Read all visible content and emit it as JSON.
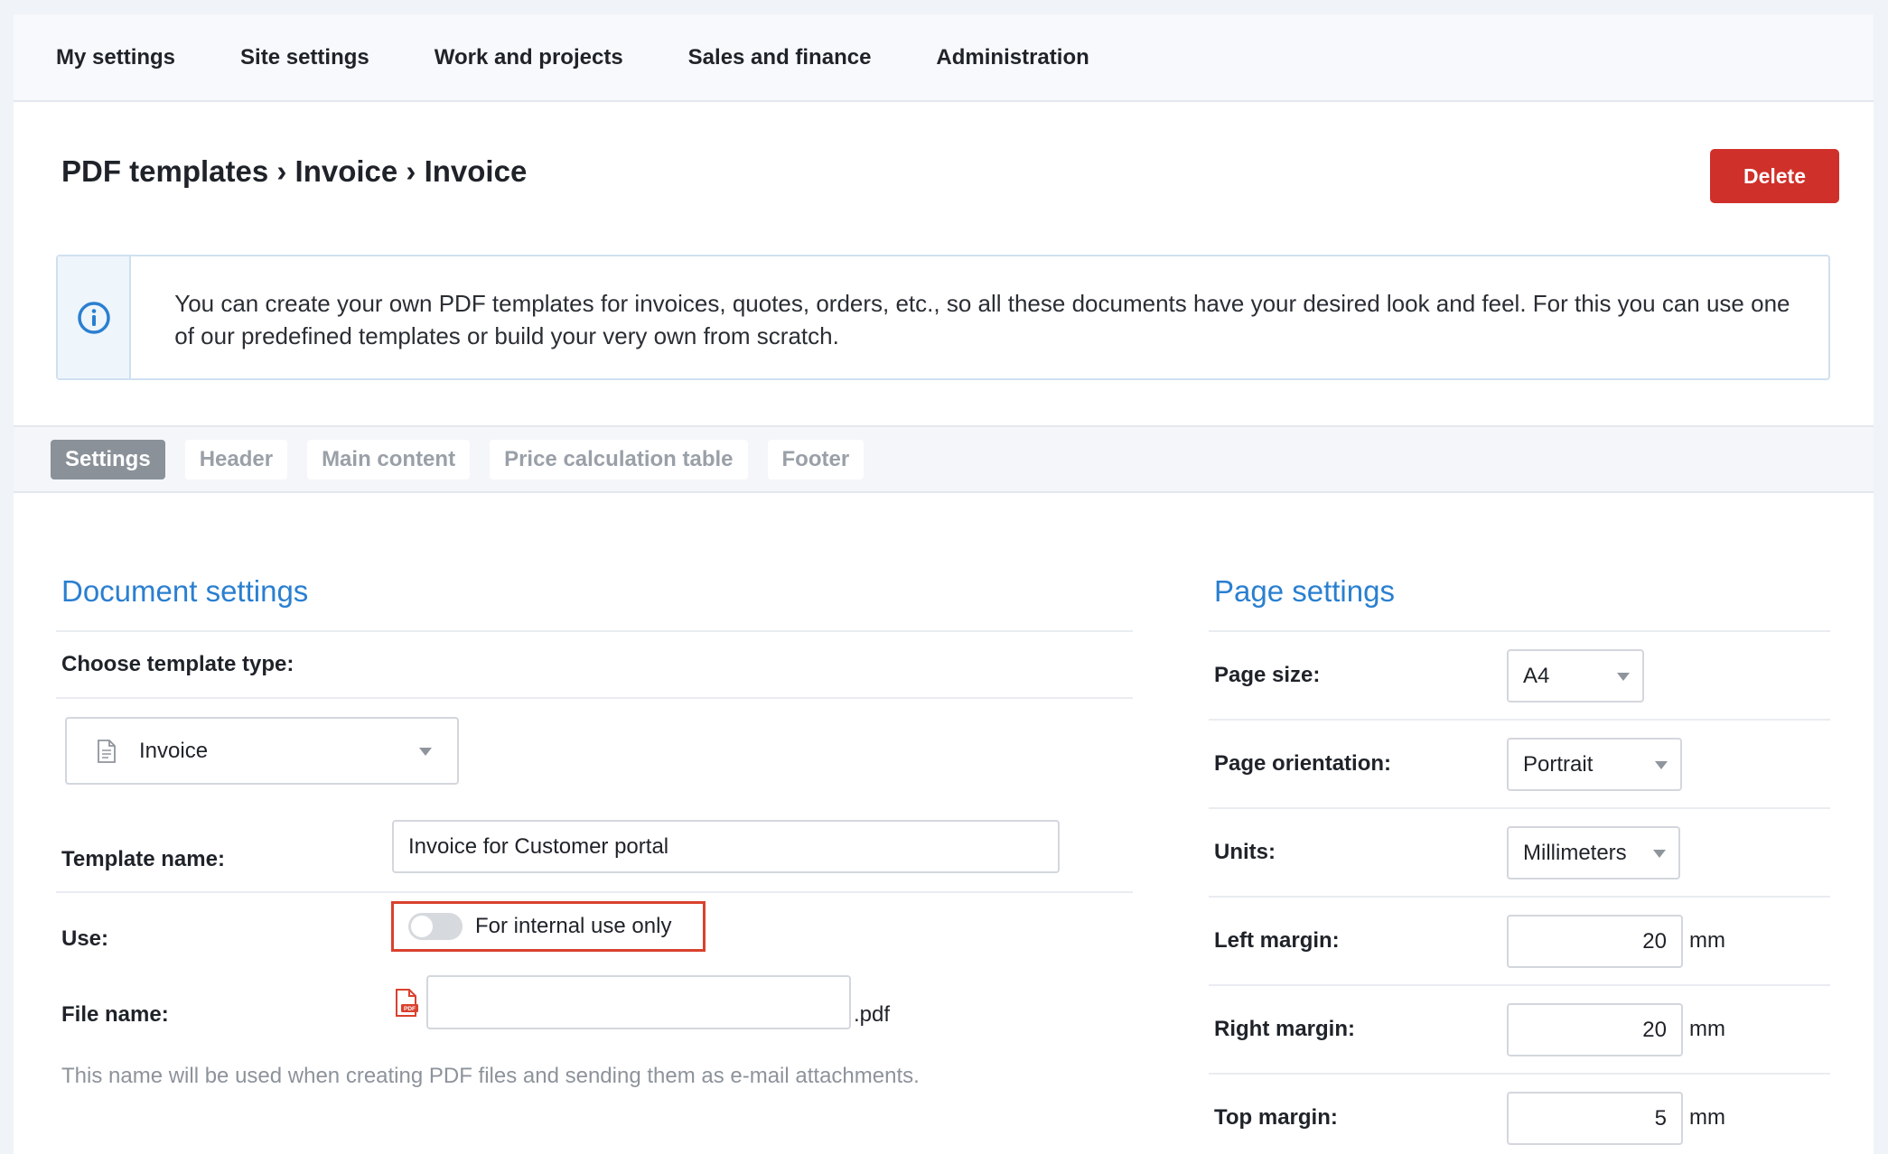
{
  "nav": {
    "items": [
      {
        "label": "My settings"
      },
      {
        "label": "Site settings"
      },
      {
        "label": "Work and projects"
      },
      {
        "label": "Sales and finance"
      },
      {
        "label": "Administration"
      }
    ]
  },
  "header": {
    "breadcrumb": "PDF templates › Invoice › Invoice",
    "delete_label": "Delete"
  },
  "info": {
    "icon": "info-icon",
    "text": "You can create your own PDF templates for invoices, quotes, orders, etc., so all these documents have your desired look and feel. For this you can use one of our predefined templates or build your very own from scratch."
  },
  "tabs": [
    {
      "label": "Settings",
      "active": true
    },
    {
      "label": "Header"
    },
    {
      "label": "Main content"
    },
    {
      "label": "Price calculation table"
    },
    {
      "label": "Footer"
    }
  ],
  "document_settings": {
    "title": "Document settings",
    "template_type_label": "Choose template type:",
    "template_type_value": "Invoice",
    "template_name_label": "Template name:",
    "template_name_value": "Invoice for Customer portal",
    "use_label": "Use:",
    "internal_use_label": "For internal use only",
    "internal_use_on": false,
    "file_name_label": "File name:",
    "file_name_value": "",
    "file_ext": ".pdf",
    "help_text": "This name will be used when creating PDF files and sending them as e-mail attachments."
  },
  "page_settings": {
    "title": "Page settings",
    "page_size_label": "Page size:",
    "page_size_value": "A4",
    "orientation_label": "Page orientation:",
    "orientation_value": "Portrait",
    "units_label": "Units:",
    "units_value": "Millimeters",
    "left_margin_label": "Left margin:",
    "left_margin_value": "20",
    "right_margin_label": "Right margin:",
    "right_margin_value": "20",
    "top_margin_label": "Top margin:",
    "top_margin_value": "5",
    "unit_suffix": "mm"
  },
  "colors": {
    "accent": "#2a7fd0",
    "danger": "#d0302a",
    "highlight_border": "#d9412e"
  }
}
